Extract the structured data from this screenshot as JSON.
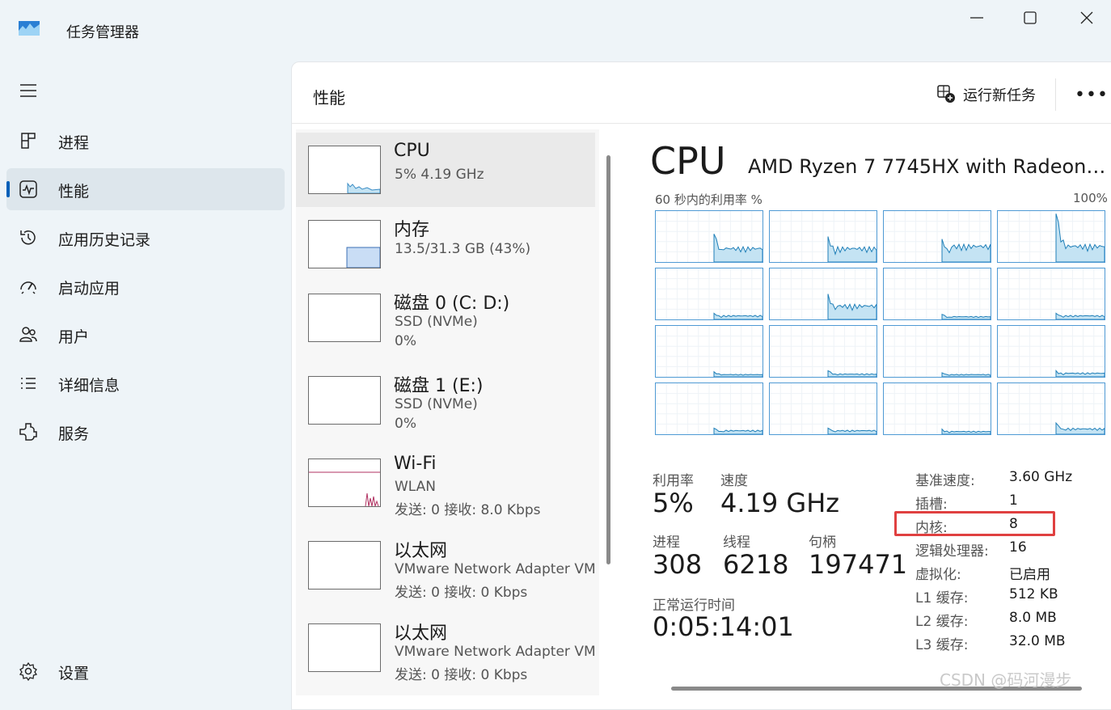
{
  "window": {
    "title": "任务管理器"
  },
  "sidebar": {
    "items": [
      {
        "label": "进程",
        "icon": "processes-icon"
      },
      {
        "label": "性能",
        "icon": "performance-icon",
        "active": true
      },
      {
        "label": "应用历史记录",
        "icon": "history-icon"
      },
      {
        "label": "启动应用",
        "icon": "startup-icon"
      },
      {
        "label": "用户",
        "icon": "users-icon"
      },
      {
        "label": "详细信息",
        "icon": "details-icon"
      },
      {
        "label": "服务",
        "icon": "services-icon"
      }
    ],
    "settings_label": "设置"
  },
  "header": {
    "title": "性能",
    "run_task_label": "运行新任务",
    "more_label": "•••"
  },
  "devices": [
    {
      "name": "CPU",
      "lines": [
        "5%  4.19 GHz"
      ],
      "selected": true
    },
    {
      "name": "内存",
      "lines": [
        "13.5/31.3 GB (43%)"
      ],
      "memory_percent": 43
    },
    {
      "name": "磁盘 0 (C: D:)",
      "lines": [
        "SSD (NVMe)",
        "0%"
      ]
    },
    {
      "name": "磁盘 1 (E:)",
      "lines": [
        "SSD (NVMe)",
        "0%"
      ]
    },
    {
      "name": "Wi-Fi",
      "lines": [
        "WLAN",
        "发送: 0 接收: 8.0 Kbps"
      ]
    },
    {
      "name": "以太网",
      "lines": [
        "VMware Network Adapter VM",
        "发送: 0 接收: 0 Kbps"
      ]
    },
    {
      "name": "以太网",
      "lines": [
        "VMware Network Adapter VM",
        "发送: 0 接收: 0 Kbps"
      ]
    }
  ],
  "cpu": {
    "title": "CPU",
    "model": "AMD Ryzen 7 7745HX with Radeon Graphics",
    "graph_caption": "60 秒内的利用率 %",
    "graph_max": "100%",
    "stats": {
      "utilization": {
        "label": "利用率",
        "value": "5%"
      },
      "speed": {
        "label": "速度",
        "value": "4.19 GHz"
      },
      "processes": {
        "label": "进程",
        "value": "308"
      },
      "threads": {
        "label": "线程",
        "value": "6218"
      },
      "handles": {
        "label": "句柄",
        "value": "197471"
      },
      "uptime": {
        "label": "正常运行时间",
        "value": "0:05:14:01"
      }
    },
    "specs": [
      {
        "key": "基准速度:",
        "value": "3.60 GHz"
      },
      {
        "key": "插槽:",
        "value": "1"
      },
      {
        "key": "内核:",
        "value": "8",
        "highlighted": true
      },
      {
        "key": "逻辑处理器:",
        "value": "16"
      },
      {
        "key": "虚拟化:",
        "value": "已启用"
      },
      {
        "key": "L1 缓存:",
        "value": "512 KB"
      },
      {
        "key": "L2 缓存:",
        "value": "8.0 MB"
      },
      {
        "key": "L3 缓存:",
        "value": "32.0 MB"
      }
    ]
  },
  "colors": {
    "accent": "#005fb8",
    "graph_line": "#4f9ad4",
    "graph_fill": "#c4e3f3",
    "highlight": "#e04040",
    "wifi_line": "#b03060"
  },
  "watermark": "CSDN @码河漫步"
}
